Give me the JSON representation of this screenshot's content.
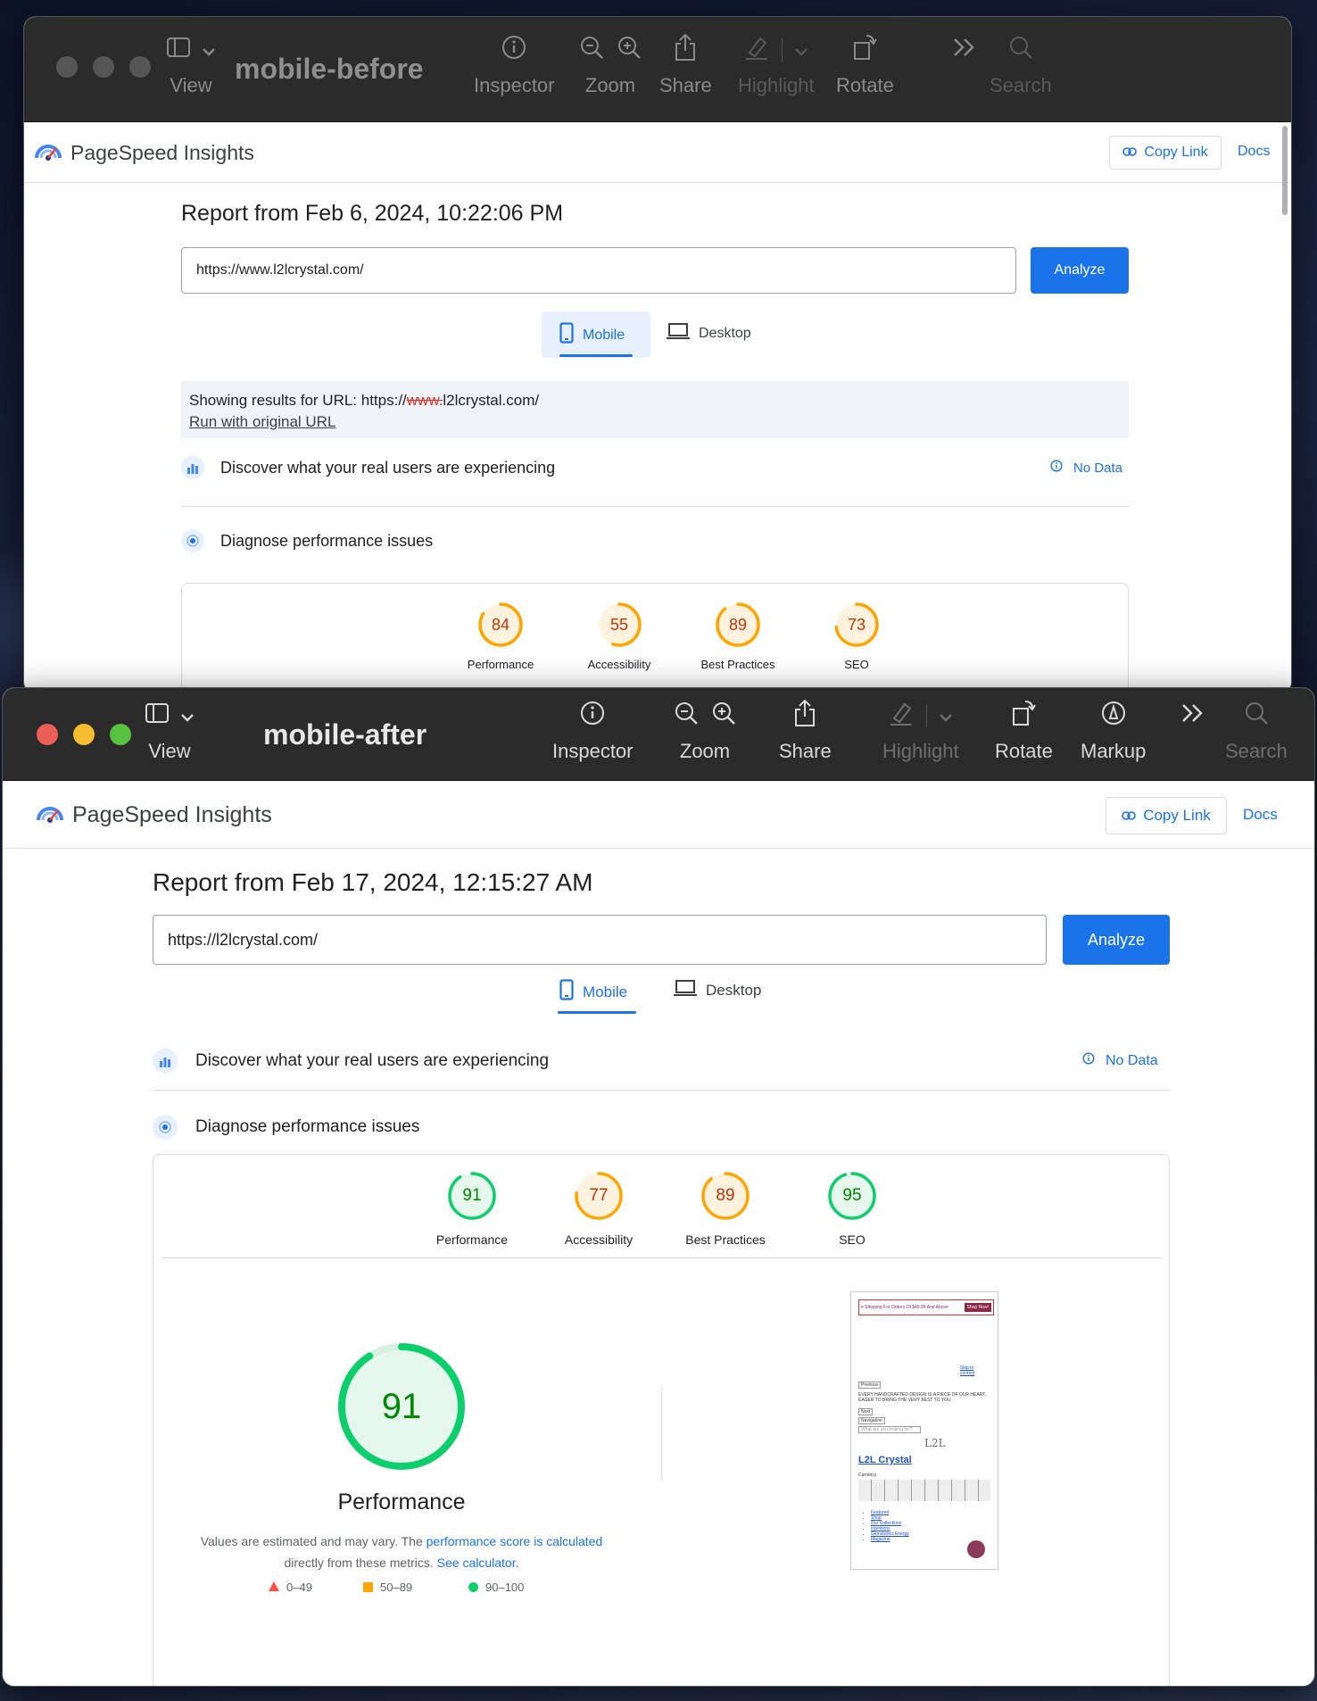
{
  "window_before": {
    "title": "mobile-before",
    "toolbar": {
      "view": "View",
      "inspector": "Inspector",
      "zoom": "Zoom",
      "share": "Share",
      "highlight": "Highlight",
      "rotate": "Rotate",
      "search": "Search"
    },
    "app_name": "PageSpeed Insights",
    "copy_link": "Copy Link",
    "docs": "Docs",
    "report_title": "Report from Feb 6, 2024, 10:22:06 PM",
    "url_value": "https://www.l2lcrystal.com/",
    "analyze": "Analyze",
    "tabs": {
      "mobile": "Mobile",
      "desktop": "Desktop"
    },
    "notice": {
      "prefix": "Showing results for URL: https://",
      "struck": "www.",
      "suffix": "l2lcrystal.com/",
      "link": "Run with original URL"
    },
    "discover": "Discover what your real users are experiencing",
    "no_data": "No Data",
    "diagnose": "Diagnose performance issues",
    "scores": [
      {
        "label": "Performance",
        "value": "84",
        "status": "average"
      },
      {
        "label": "Accessibility",
        "value": "55",
        "status": "average"
      },
      {
        "label": "Best Practices",
        "value": "89",
        "status": "average"
      },
      {
        "label": "SEO",
        "value": "73",
        "status": "average"
      }
    ]
  },
  "window_after": {
    "title": "mobile-after",
    "toolbar": {
      "view": "View",
      "inspector": "Inspector",
      "zoom": "Zoom",
      "share": "Share",
      "highlight": "Highlight",
      "rotate": "Rotate",
      "markup": "Markup",
      "search": "Search"
    },
    "app_name": "PageSpeed Insights",
    "copy_link": "Copy Link",
    "docs": "Docs",
    "report_title": "Report from Feb 17, 2024, 12:15:27 AM",
    "url_value": "https://l2lcrystal.com/",
    "analyze": "Analyze",
    "tabs": {
      "mobile": "Mobile",
      "desktop": "Desktop"
    },
    "discover": "Discover what your real users are experiencing",
    "no_data": "No Data",
    "diagnose": "Diagnose performance issues",
    "scores": [
      {
        "label": "Performance",
        "value": "91",
        "status": "good"
      },
      {
        "label": "Accessibility",
        "value": "77",
        "status": "average"
      },
      {
        "label": "Best Practices",
        "value": "89",
        "status": "average"
      },
      {
        "label": "SEO",
        "value": "95",
        "status": "good"
      }
    ],
    "big_score": {
      "value": "91",
      "label": "Performance"
    },
    "note": {
      "pre": "Values are estimated and may vary. The ",
      "link1": "performance score is calculated",
      "mid": " directly from these metrics. ",
      "link2": "See calculator."
    },
    "legend": {
      "poor": "0–49",
      "average": "50–89",
      "good": "90–100"
    },
    "thumbnail": {
      "banner": "e Shipping For Orders Of $49.99 And Above",
      "banner_btn": "Shop Now!",
      "skip": "Skip to content",
      "previous": "Previous",
      "headline": "EVERY HANDCRAFTED DESIGN IS A PIECE OF OUR HEART, EAGER TO BRING THE VERY BEST TO YOU",
      "next": "Next",
      "navigation": "Navigation",
      "search_ph": "What are you looking for?",
      "brand": "L2L Crystal",
      "currency": "Currency",
      "nav_items": [
        "Featured",
        "Shop",
        "Our Collections",
        "Intentions",
        "Gemstones Energy",
        "Magazine"
      ]
    }
  },
  "colors": {
    "good": "#0cce6b",
    "good_text": "#008800",
    "average": "#ffa400",
    "average_text": "#c33300",
    "poor": "#ff4e42",
    "blue": "#1a73e8"
  }
}
